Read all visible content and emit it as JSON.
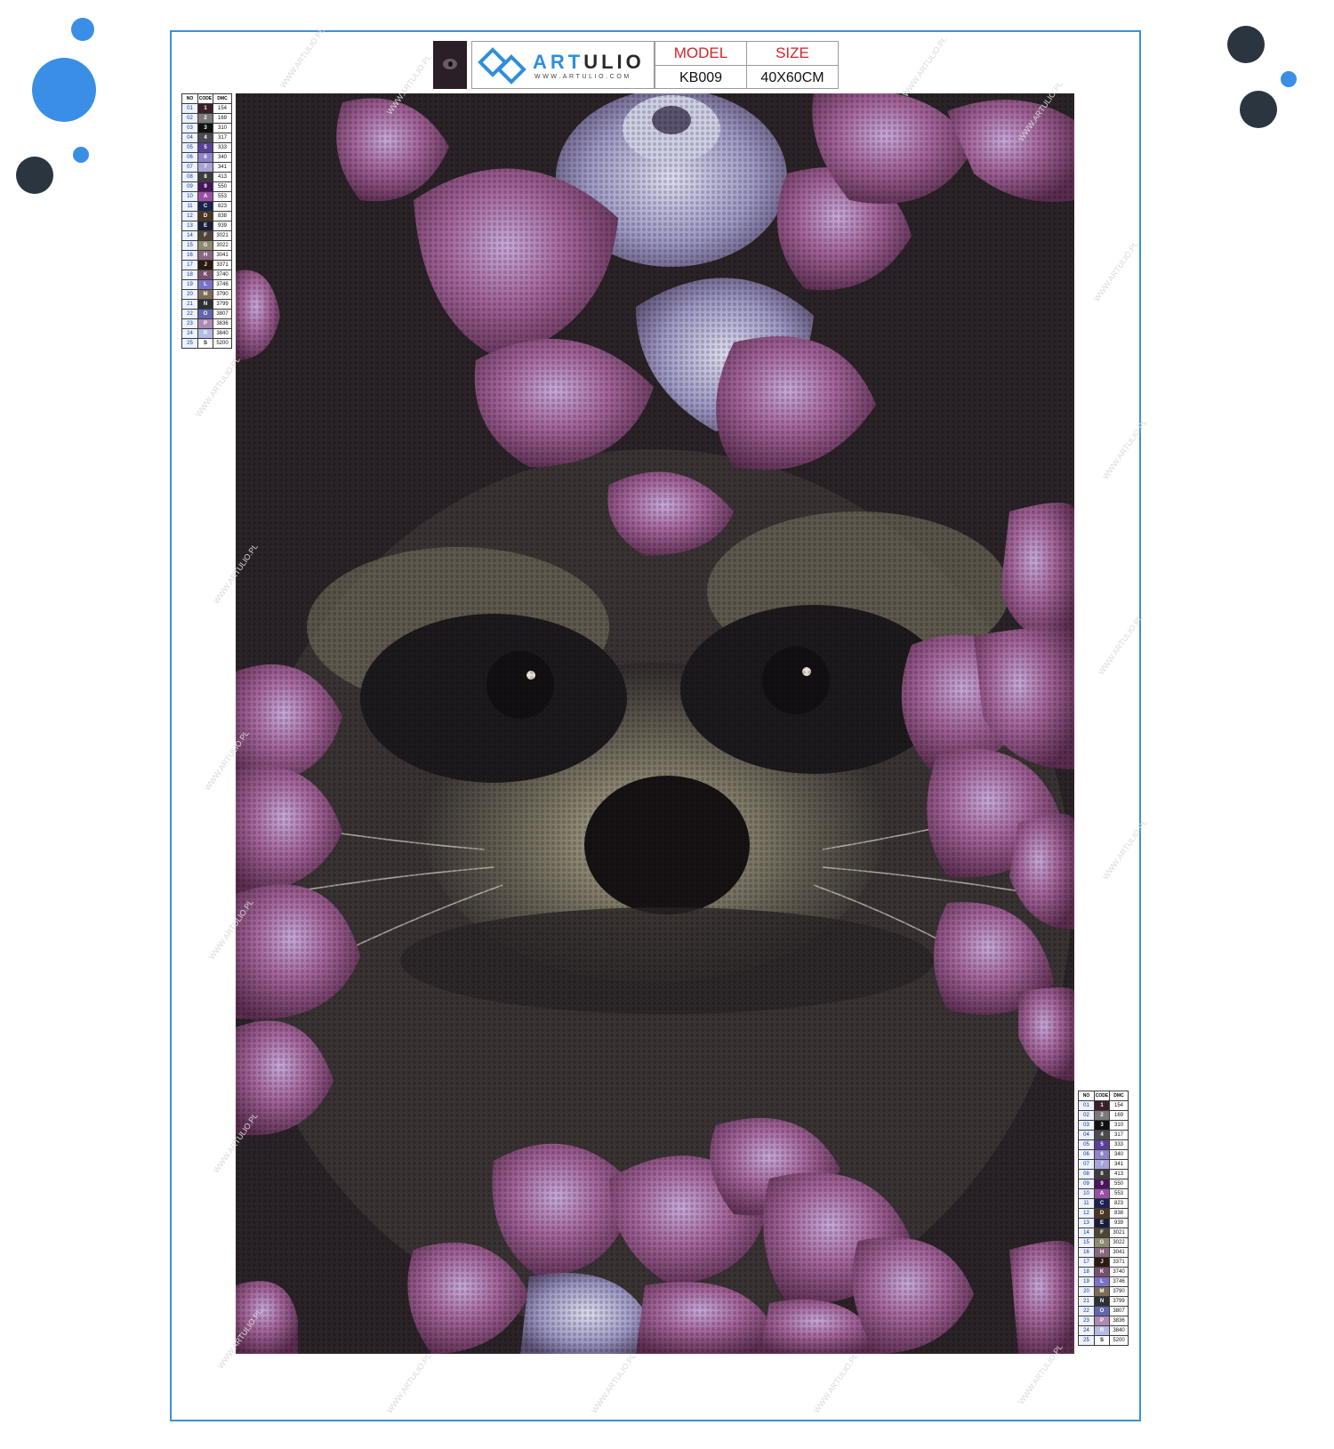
{
  "brand": {
    "name_part1": "ART",
    "name_part2": "ULIO",
    "url": "WWW.ARTULIO.COM",
    "accent": "#2f8fd8"
  },
  "spec": {
    "model_label": "MODEL",
    "model_value": "KB009",
    "size_label": "SIZE",
    "size_value": "40X60CM"
  },
  "legend": {
    "headers": [
      "NO",
      "CODE",
      "DMC"
    ],
    "rows": [
      {
        "no": "01",
        "code": "1",
        "dmc": "154",
        "color": "#3b1f2b"
      },
      {
        "no": "02",
        "code": "2",
        "dmc": "169",
        "color": "#7a7a7a"
      },
      {
        "no": "03",
        "code": "3",
        "dmc": "310",
        "color": "#111111"
      },
      {
        "no": "04",
        "code": "4",
        "dmc": "317",
        "color": "#4b4b52"
      },
      {
        "no": "05",
        "code": "5",
        "dmc": "333",
        "color": "#5c3f99"
      },
      {
        "no": "06",
        "code": "6",
        "dmc": "340",
        "color": "#8f84c9"
      },
      {
        "no": "07",
        "code": "7",
        "dmc": "341",
        "color": "#a7a3d6"
      },
      {
        "no": "08",
        "code": "8",
        "dmc": "413",
        "color": "#3d3d3d"
      },
      {
        "no": "09",
        "code": "9",
        "dmc": "550",
        "color": "#4a1460"
      },
      {
        "no": "10",
        "code": "A",
        "dmc": "553",
        "color": "#9a4fa6"
      },
      {
        "no": "11",
        "code": "C",
        "dmc": "823",
        "color": "#1c2250"
      },
      {
        "no": "12",
        "code": "D",
        "dmc": "838",
        "color": "#4a3524"
      },
      {
        "no": "13",
        "code": "E",
        "dmc": "939",
        "color": "#1b1d3a"
      },
      {
        "no": "14",
        "code": "F",
        "dmc": "3021",
        "color": "#4e4435"
      },
      {
        "no": "15",
        "code": "G",
        "dmc": "3022",
        "color": "#8c8a72"
      },
      {
        "no": "16",
        "code": "H",
        "dmc": "3041",
        "color": "#8a6680"
      },
      {
        "no": "17",
        "code": "J",
        "dmc": "3371",
        "color": "#2a1a10"
      },
      {
        "no": "18",
        "code": "K",
        "dmc": "3740",
        "color": "#7a506f"
      },
      {
        "no": "19",
        "code": "L",
        "dmc": "3746",
        "color": "#7a72c8"
      },
      {
        "no": "20",
        "code": "M",
        "dmc": "3790",
        "color": "#7b6c5a"
      },
      {
        "no": "21",
        "code": "N",
        "dmc": "3799",
        "color": "#2f3034"
      },
      {
        "no": "22",
        "code": "O",
        "dmc": "3807",
        "color": "#6266b0"
      },
      {
        "no": "23",
        "code": "P",
        "dmc": "3836",
        "color": "#ad8ab2"
      },
      {
        "no": "24",
        "code": "R",
        "dmc": "3840",
        "color": "#b4bbe6"
      },
      {
        "no": "25",
        "code": "S",
        "dmc": "5200",
        "color": "#ffffff"
      }
    ]
  },
  "watermark": "WWW.ARTULIO.PL",
  "colors": {
    "frame": "#3d8fd6",
    "dot_blue": "#3a8ee6",
    "dot_dark": "#2b3540",
    "petal": "#a4659a"
  }
}
